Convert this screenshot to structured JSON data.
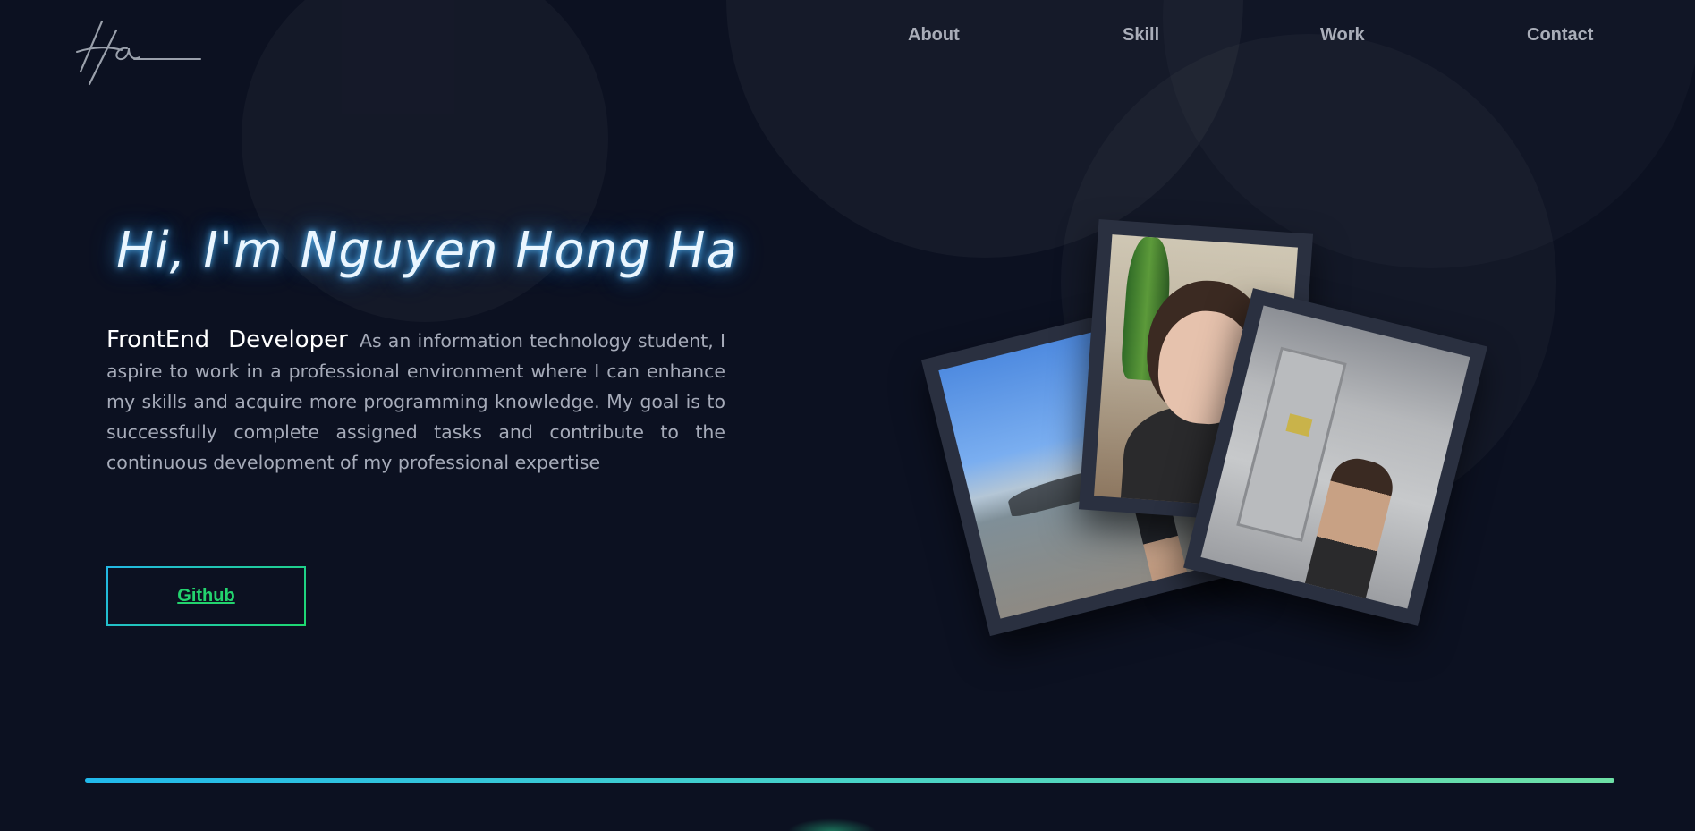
{
  "header": {
    "logo_icon": "signature-logo-icon",
    "nav": [
      {
        "label": "About"
      },
      {
        "label": "Skill"
      },
      {
        "label": "Work"
      },
      {
        "label": "Contact"
      }
    ]
  },
  "hero": {
    "title": "Hi, I'm Nguyen Hong Ha",
    "role": "FrontEnd Developer",
    "description": "As an information technology student, I aspire to work in a professional environment where I can enhance my skills and acquire more programming knowledge. My goal is to successfully complete assigned tasks and contribute to the continuous development of my professional expertise",
    "github_label": "Github"
  },
  "colors": {
    "background": "#0c1121",
    "accent_blue": "#21b9ec",
    "accent_green": "#23d46e",
    "title_glow": "#3aa8ff"
  }
}
